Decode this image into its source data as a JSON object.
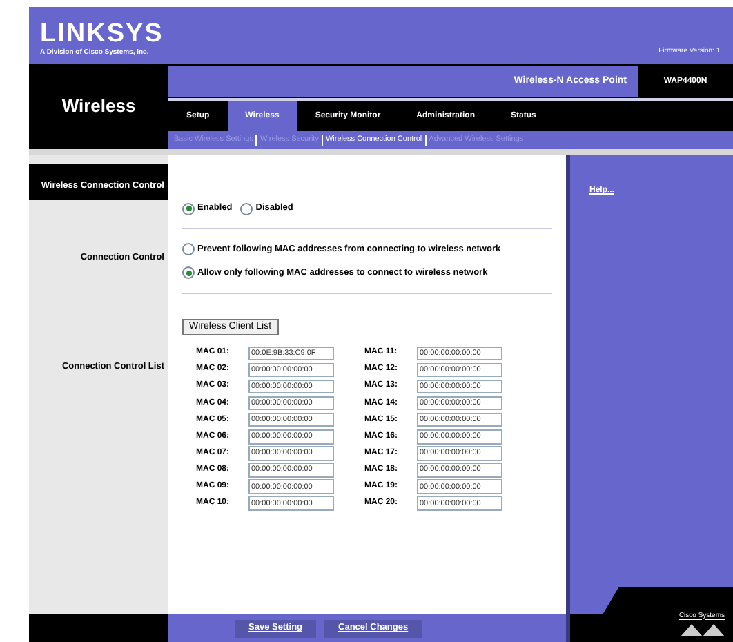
{
  "header": {
    "logo": "LINKSYS",
    "tagline": "A Division of Cisco Systems, Inc.",
    "firmware": "Firmware Version: 1."
  },
  "section_title": "Wireless",
  "product_name": "Wireless-N Access Point",
  "model": "WAP4400N",
  "tabs": [
    {
      "label": "Setup",
      "selected": false
    },
    {
      "label": "Wireless",
      "selected": true
    },
    {
      "label": "Security Monitor",
      "selected": false
    },
    {
      "label": "Administration",
      "selected": false
    },
    {
      "label": "Status",
      "selected": false
    }
  ],
  "subtabs": [
    {
      "label": "Basic Wireless Settings",
      "selected": false
    },
    {
      "label": "Wireless Security",
      "selected": false
    },
    {
      "label": "Wireless Connection Control",
      "selected": true
    },
    {
      "label": "Advanced Wireless Settings",
      "selected": false
    }
  ],
  "page_heading": "Wireless Connection Control",
  "status_options": [
    {
      "label": "Enabled",
      "selected": true
    },
    {
      "label": "Disabled",
      "selected": false
    }
  ],
  "connection_control": {
    "label": "Connection Control",
    "options": [
      {
        "label": "Prevent following MAC addresses from connecting to wireless network",
        "selected": false
      },
      {
        "label": "Allow only following MAC addresses to connect to wireless network",
        "selected": true
      }
    ]
  },
  "client_list_button": "Wireless Client List",
  "mac_list": {
    "label": "Connection Control List",
    "columns": [
      [
        {
          "label": "MAC 01:",
          "value": "00:0E:9B:33:C9:0F"
        },
        {
          "label": "MAC 02:",
          "value": "00:00:00:00:00:00"
        },
        {
          "label": "MAC 03:",
          "value": "00:00:00:00:00:00"
        },
        {
          "label": "MAC 04:",
          "value": "00:00:00:00:00:00"
        },
        {
          "label": "MAC 05:",
          "value": "00:00:00:00:00:00"
        },
        {
          "label": "MAC 06:",
          "value": "00:00:00:00:00:00"
        },
        {
          "label": "MAC 07:",
          "value": "00:00:00:00:00:00"
        },
        {
          "label": "MAC 08:",
          "value": "00:00:00:00:00:00"
        },
        {
          "label": "MAC 09:",
          "value": "00:00:00:00:00:00"
        },
        {
          "label": "MAC 10:",
          "value": "00:00:00:00:00:00"
        }
      ],
      [
        {
          "label": "MAC 11:",
          "value": "00:00:00:00:00:00"
        },
        {
          "label": "MAC 12:",
          "value": "00:00:00:00:00:00"
        },
        {
          "label": "MAC 13:",
          "value": "00:00:00:00:00:00"
        },
        {
          "label": "MAC 14:",
          "value": "00:00:00:00:00:00"
        },
        {
          "label": "MAC 15:",
          "value": "00:00:00:00:00:00"
        },
        {
          "label": "MAC 16:",
          "value": "00:00:00:00:00:00"
        },
        {
          "label": "MAC 17:",
          "value": "00:00:00:00:00:00"
        },
        {
          "label": "MAC 18:",
          "value": "00:00:00:00:00:00"
        },
        {
          "label": "MAC 19:",
          "value": "00:00:00:00:00:00"
        },
        {
          "label": "MAC 20:",
          "value": "00:00:00:00:00:00"
        }
      ]
    ]
  },
  "help_link": "Help...",
  "cisco_logo": "Cisco Systems",
  "footer_buttons": [
    "Save Setting",
    "Cancel Changes"
  ]
}
